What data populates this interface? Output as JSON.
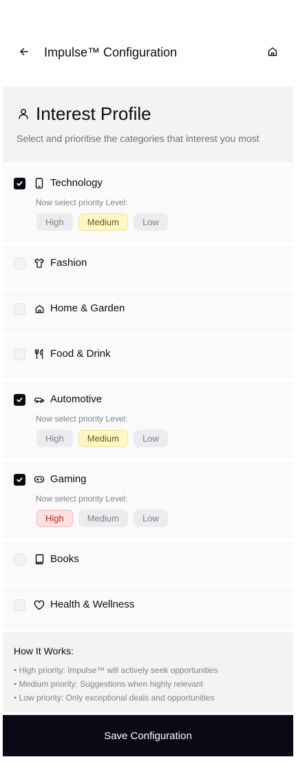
{
  "header": {
    "title": "Impulse™ Configuration",
    "back_icon": "arrow-left-icon",
    "home_icon": "home-icon"
  },
  "profile": {
    "title": "Interest Profile",
    "subtitle": "Select and prioritise the categories that interest you most",
    "icon": "user-icon"
  },
  "priority_hint": "Now select priority Level:",
  "priority_options": [
    "High",
    "Medium",
    "Low"
  ],
  "categories": [
    {
      "label": "Technology",
      "icon": "smartphone-icon",
      "checked": true,
      "priority": "Medium"
    },
    {
      "label": "Fashion",
      "icon": "shirt-icon",
      "checked": false
    },
    {
      "label": "Home & Garden",
      "icon": "home-icon",
      "checked": false
    },
    {
      "label": "Food & Drink",
      "icon": "utensils-icon",
      "checked": false
    },
    {
      "label": "Automotive",
      "icon": "car-icon",
      "checked": true,
      "priority": "Medium"
    },
    {
      "label": "Gaming",
      "icon": "gamepad-icon",
      "checked": true,
      "priority": "High"
    },
    {
      "label": "Books",
      "icon": "book-icon",
      "checked": false
    },
    {
      "label": "Health & Wellness",
      "icon": "heart-icon",
      "checked": false
    }
  ],
  "how_it_works": {
    "title": "How It Works:",
    "items": [
      "• High priority: Impulse™ will actively seek opportunities",
      "• Medium priority: Suggestions when highly relevant",
      "• Low priority: Only exceptional deals and opportunities"
    ]
  },
  "save_label": "Save Configuration",
  "colors": {
    "primary": "#0a0a17",
    "medium_selected_bg": "#fdf6c7",
    "high_selected_bg": "#fde0e0"
  }
}
